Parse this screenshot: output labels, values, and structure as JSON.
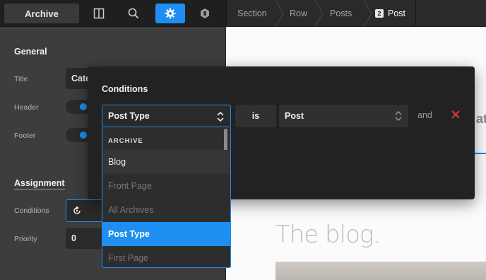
{
  "toolbar": {
    "archive_label": "Archive",
    "icons": [
      "panel-icon",
      "search-icon",
      "gear-icon",
      "hexagon-icon"
    ],
    "accent": "#1e8ff0"
  },
  "breadcrumb": {
    "items": [
      "Section",
      "Row",
      "Posts"
    ],
    "current_badge": "2",
    "current_label": "Post"
  },
  "panel": {
    "general_title": "General",
    "title_label": "Title",
    "title_value": "Cate",
    "header_label": "Header",
    "footer_label": "Footer",
    "assignment_title": "Assignment",
    "conditions_label": "Conditions",
    "priority_label": "Priority",
    "priority_value": "0"
  },
  "modal": {
    "title": "Conditions",
    "rule_type": "Post Type",
    "operator": "is",
    "rule_value": "Post",
    "joiner": "and"
  },
  "dropdown": {
    "group_label": "ARCHIVE",
    "items": [
      {
        "label": "Blog",
        "state": "hover"
      },
      {
        "label": "Front Page",
        "state": "disabled"
      },
      {
        "label": "All Archives",
        "state": "disabled"
      },
      {
        "label": "Post Type",
        "state": "selected"
      },
      {
        "label": "First Page",
        "state": "disabled"
      }
    ]
  },
  "canvas": {
    "heading": "The blog.",
    "partial_text": "at"
  }
}
